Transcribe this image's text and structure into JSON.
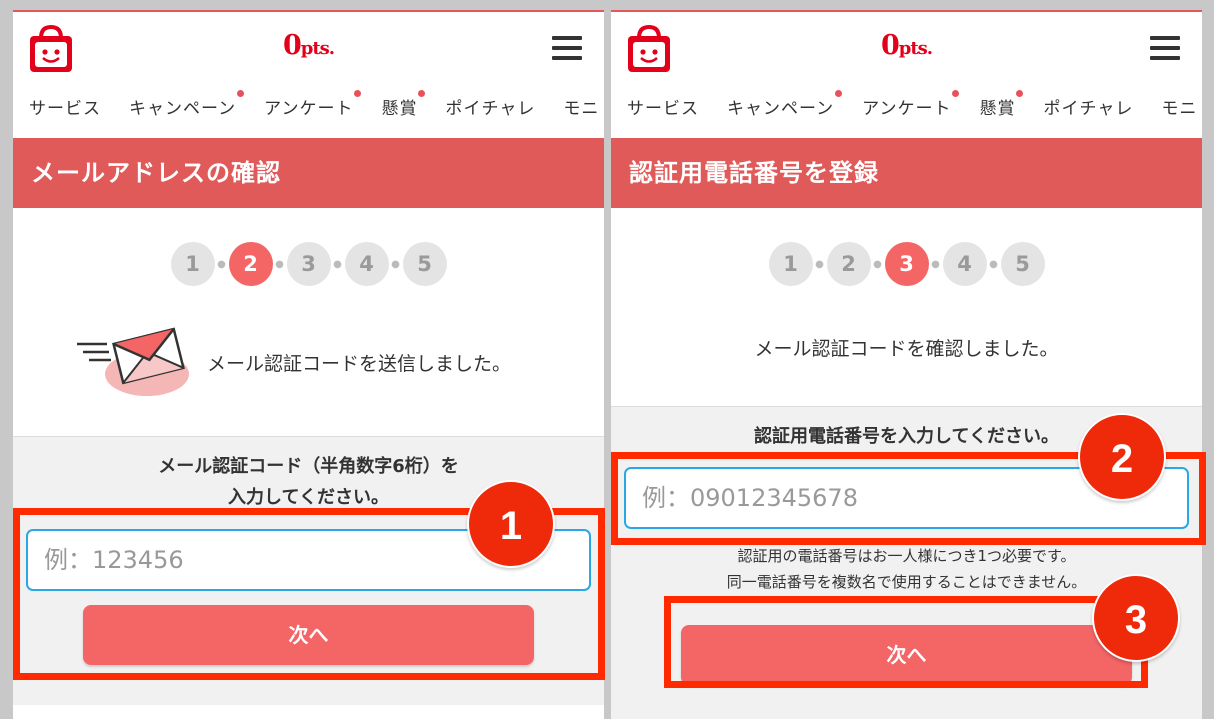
{
  "header": {
    "points_value": "0",
    "points_unit": "pts."
  },
  "nav": {
    "items": [
      {
        "label": "サービス",
        "dot": false
      },
      {
        "label": "キャンペーン",
        "dot": true
      },
      {
        "label": "アンケート",
        "dot": true
      },
      {
        "label": "懸賞",
        "dot": true
      },
      {
        "label": "ポイチャレ",
        "dot": false
      },
      {
        "label": "モニ",
        "dot": false
      }
    ]
  },
  "left": {
    "title": "メールアドレスの確認",
    "steps": [
      "1",
      "2",
      "3",
      "4",
      "5"
    ],
    "active_step": 2,
    "sent_message": "メール認証コードを送信しました。",
    "instruction_line1": "メール認証コード（半角数字6桁）を",
    "instruction_line2": "入力してください。",
    "input_placeholder": "例：123456",
    "next_label": "次へ",
    "badge": "1"
  },
  "right": {
    "title": "認証用電話番号を登録",
    "steps": [
      "1",
      "2",
      "3",
      "4",
      "5"
    ],
    "active_step": 3,
    "confirm_message": "メール認証コードを確認しました。",
    "instruction": "認証用電話番号を入力してください。",
    "input_placeholder": "例：09012345678",
    "note_line1": "認証用の電話番号はお一人様につき1つ必要です。",
    "note_line2": "同一電話番号を複数名で使用することはできません。",
    "next_label": "次へ",
    "badge_phone": "2",
    "badge_next": "3"
  },
  "colors": {
    "brand_red": "#e3001b",
    "title_bar": "#e05a5a",
    "active_step": "#f46565",
    "button": "#f46565",
    "input_border": "#2aa8e6",
    "highlight": "#ff2a00"
  }
}
